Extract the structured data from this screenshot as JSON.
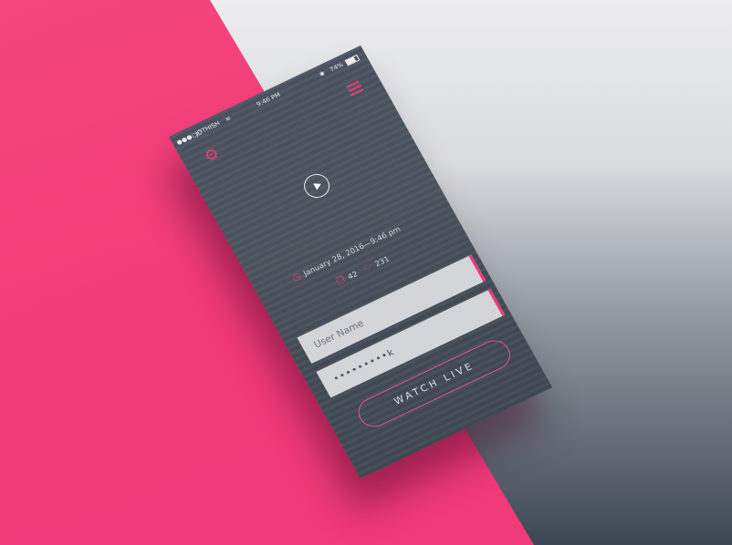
{
  "status_bar": {
    "signal": "●●●○○",
    "carrier": "JOTHISH",
    "time": "9:46 PM",
    "bluetooth": "✱",
    "battery": "74%"
  },
  "icons": {
    "settings": "gear-icon",
    "menu": "hamburger-icon",
    "play": "play-icon",
    "clock": "clock-icon",
    "comments": "comment-icon",
    "likes": "heart-icon"
  },
  "video": {
    "date": "January 28, 2016—9:46 pm",
    "comments": "42",
    "likes": "231"
  },
  "form": {
    "username_placeholder": "User Name",
    "password_value": "•••••••••k",
    "watch_live_label": "WATCH LIVE"
  },
  "colors": {
    "accent": "#f03a7a",
    "phone": "#4b5461",
    "background_right": "#d9dbde"
  }
}
